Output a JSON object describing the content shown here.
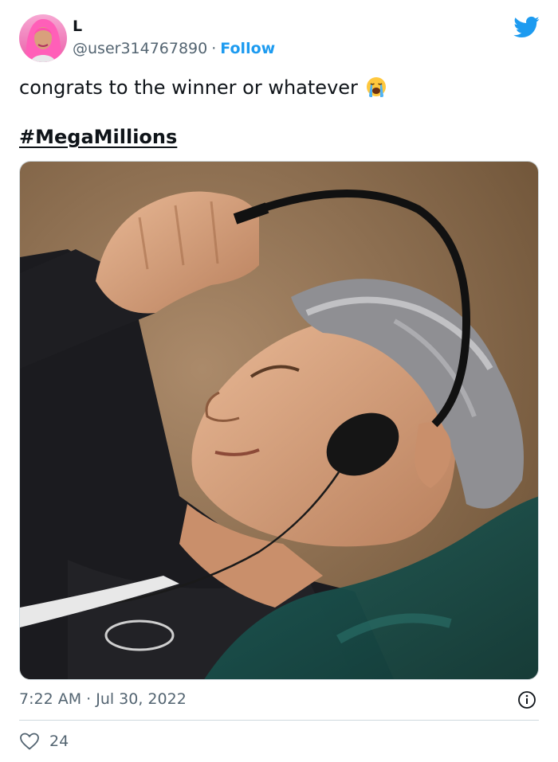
{
  "author": {
    "display_name": "L",
    "handle": "@user314767890",
    "separator": "·",
    "follow_label": "Follow",
    "avatar_icon": "profile-photo"
  },
  "brand": {
    "icon": "twitter-bird-icon",
    "color": "#1d9bf0"
  },
  "tweet": {
    "text": "congrats to the winner or whatever",
    "emoji_icon": "loudly-crying-face-emoji",
    "hashtag": "#MegaMillions"
  },
  "media": {
    "type": "photo"
  },
  "meta": {
    "timestamp": "7:22 AM · Jul 30, 2022",
    "like_count": "24"
  },
  "colors": {
    "text": "#0f1419",
    "secondary": "#536471",
    "accent": "#1d9bf0",
    "divider": "#cfd9de"
  }
}
